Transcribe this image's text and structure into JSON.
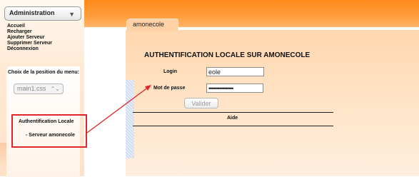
{
  "menu": {
    "button_label": "Administration",
    "items": [
      "Accueil",
      "Recharger",
      "Ajouter Serveur",
      "Supprimer Serveur",
      "Déconnexion"
    ]
  },
  "position": {
    "title": "Choix de la position du menu:",
    "selected": "main1.css"
  },
  "nav": {
    "auth_label": "Authentification Locale",
    "server_link": "- Serveur amonecole"
  },
  "tab": {
    "label": "amonecole"
  },
  "form": {
    "heading": "AUTHENTIFICATION LOCALE SUR AMONECOLE",
    "login_label": "Login",
    "login_value": "eole",
    "password_label": "Mot de passe",
    "password_value": "••••••••••••••••",
    "submit_label": "Valider",
    "help_label": "Aide"
  },
  "colors": {
    "banner": "#ff8a1a",
    "highlight": "#e0262b"
  }
}
